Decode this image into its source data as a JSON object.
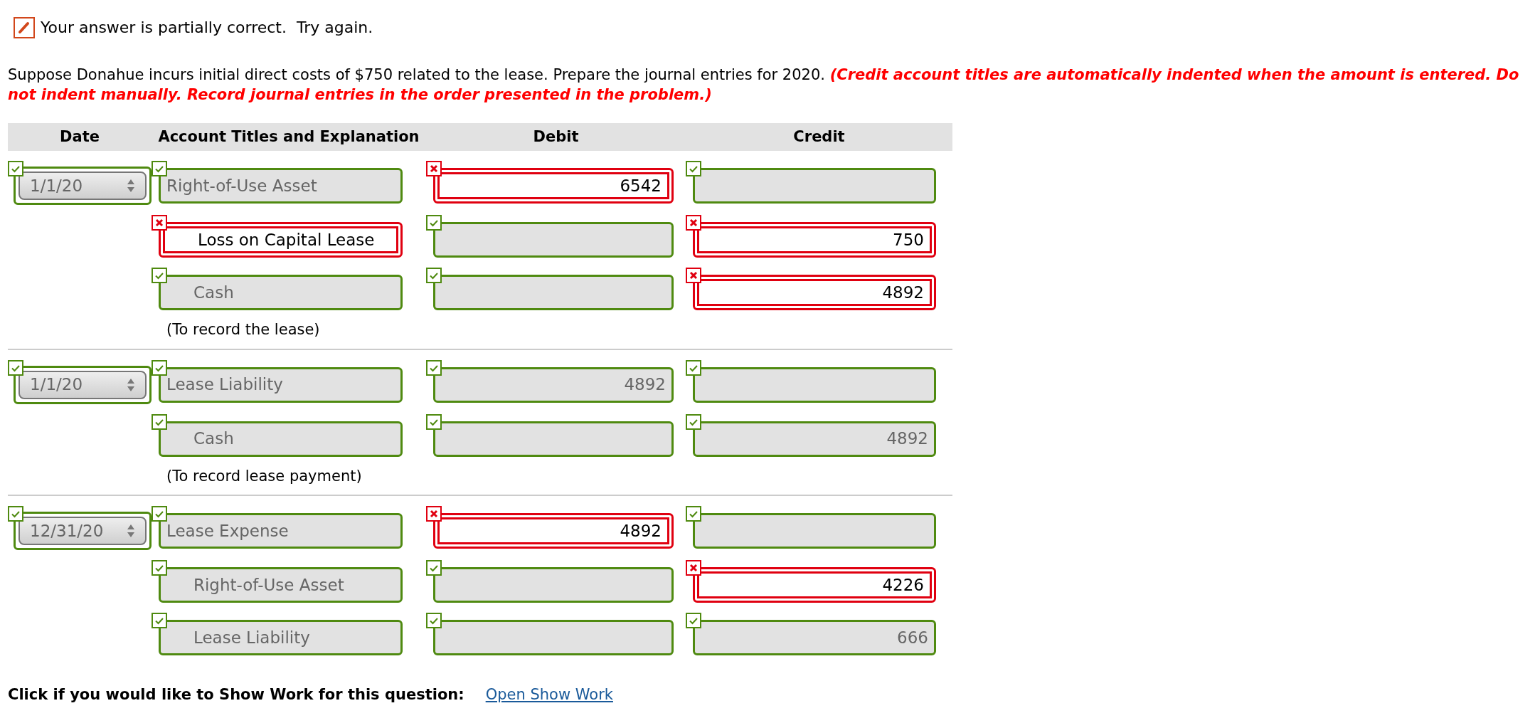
{
  "feedback": {
    "message": "Your answer is partially correct.  Try again."
  },
  "question": {
    "text": "Suppose Donahue incurs initial direct costs of $750 related to the lease. Prepare the journal entries for 2020.",
    "instruction": "(Credit account titles are automatically indented when the amount is entered. Do not indent manually. Record journal entries in the order presented in the problem.)"
  },
  "table": {
    "columns": [
      "Date",
      "Account Titles and Explanation",
      "Debit",
      "Credit"
    ],
    "entries": [
      {
        "date": "1/1/20",
        "date_correct": true,
        "note": "(To record the lease)",
        "lines": [
          {
            "account": "Right-of-Use Asset",
            "indented": false,
            "account_correct": true,
            "debit": "6542",
            "debit_correct": false,
            "credit_correct": true
          },
          {
            "account": "Loss on Capital Lease",
            "indented": true,
            "account_correct": false,
            "debit_correct": true,
            "credit": "750",
            "credit_correct": false
          },
          {
            "account": "Cash",
            "indented": true,
            "account_correct": true,
            "debit_correct": true,
            "credit": "4892",
            "credit_correct": false
          }
        ]
      },
      {
        "date": "1/1/20",
        "date_correct": true,
        "note": "(To record lease payment)",
        "lines": [
          {
            "account": "Lease Liability",
            "indented": false,
            "account_correct": true,
            "debit": "4892",
            "debit_correct": true,
            "credit_correct": true
          },
          {
            "account": "Cash",
            "indented": true,
            "account_correct": true,
            "debit_correct": true,
            "credit": "4892",
            "credit_correct": true
          }
        ]
      },
      {
        "date": "12/31/20",
        "date_correct": true,
        "lines": [
          {
            "account": "Lease Expense",
            "indented": false,
            "account_correct": true,
            "debit": "4892",
            "debit_correct": false,
            "credit_correct": true
          },
          {
            "account": "Right-of-Use Asset",
            "indented": true,
            "account_correct": true,
            "debit_correct": true,
            "credit": "4226",
            "credit_correct": false
          },
          {
            "account": "Lease Liability",
            "indented": true,
            "account_correct": true,
            "debit_correct": true,
            "credit": "666",
            "credit_correct": true
          }
        ]
      }
    ]
  },
  "footer": {
    "prompt": "Click if you would like to Show Work for this question:",
    "link": "Open Show Work"
  }
}
